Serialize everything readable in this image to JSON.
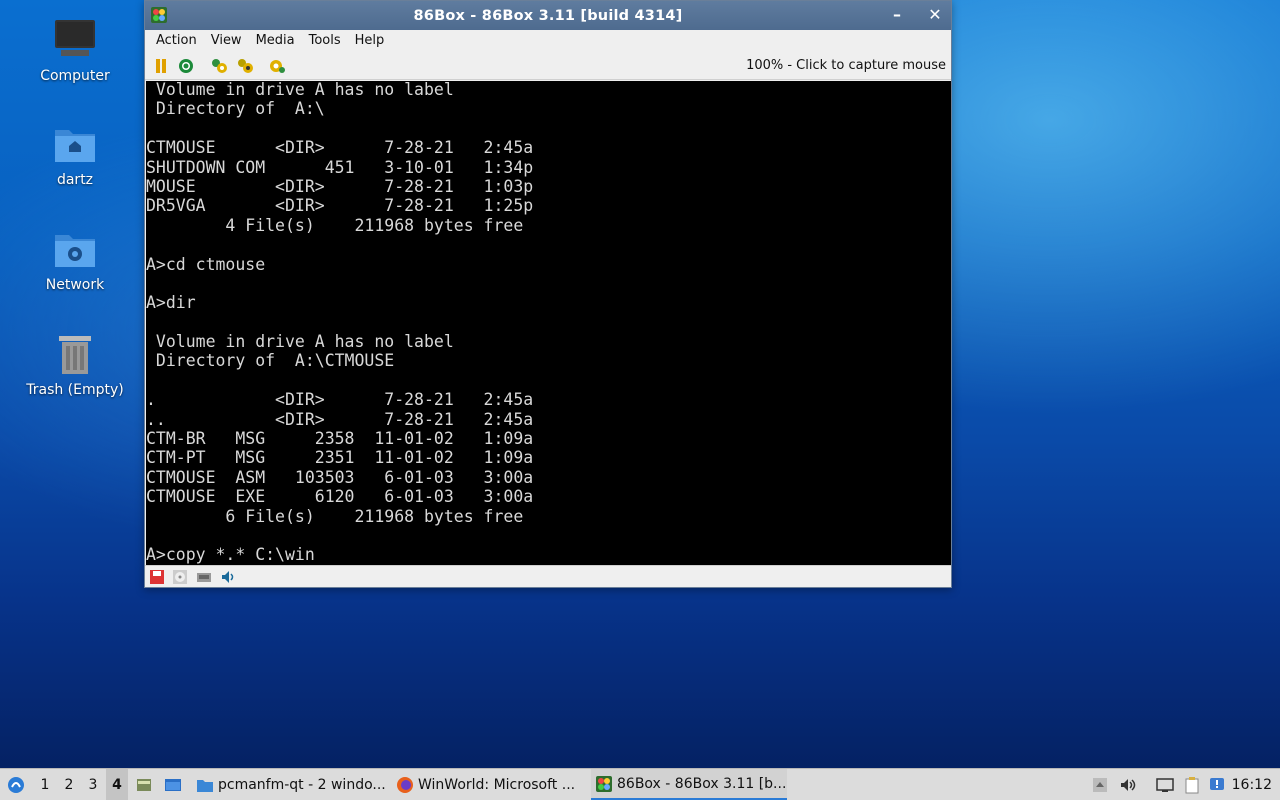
{
  "desktop": {
    "icons": [
      {
        "label": "Computer"
      },
      {
        "label": "dartz"
      },
      {
        "label": "Network"
      },
      {
        "label": "Trash (Empty)"
      }
    ]
  },
  "window": {
    "title": "86Box - 86Box 3.11 [build 4314]",
    "menu": [
      "Action",
      "View",
      "Media",
      "Tools",
      "Help"
    ],
    "toolbar": {
      "icons": [
        "pause-icon",
        "reset-icon",
        "ctrl-alt-del-icon",
        "ctrl-alt-esc-icon",
        "settings-icon"
      ],
      "status_text": "100% - Click to capture mouse"
    },
    "screen_lines": [
      " Volume in drive A has no label",
      " Directory of  A:\\",
      "",
      "CTMOUSE      <DIR>      7-28-21   2:45a",
      "SHUTDOWN COM      451   3-10-01   1:34p",
      "MOUSE        <DIR>      7-28-21   1:03p",
      "DR5VGA       <DIR>      7-28-21   1:25p",
      "        4 File(s)    211968 bytes free",
      "",
      "A>cd ctmouse",
      "",
      "A>dir",
      "",
      " Volume in drive A has no label",
      " Directory of  A:\\CTMOUSE",
      "",
      ".            <DIR>      7-28-21   2:45a",
      "..           <DIR>      7-28-21   2:45a",
      "CTM-BR   MSG     2358  11-01-02   1:09a",
      "CTM-PT   MSG     2351  11-01-02   1:09a",
      "CTMOUSE  ASM   103503   6-01-03   3:00a",
      "CTMOUSE  EXE     6120   6-01-03   3:00a",
      "        6 File(s)    211968 bytes free",
      "",
      "A>copy *.* C:\\win"
    ],
    "statusbar_icons": [
      "floppy-icon",
      "cdrom-icon",
      "hdd-icon",
      "sound-icon"
    ]
  },
  "taskbar": {
    "desktops": [
      "1",
      "2",
      "3",
      "4"
    ],
    "active_desktop": "4",
    "tasks": [
      {
        "label": "pcmanfm-qt - 2 windo..."
      },
      {
        "label": "WinWorld: Microsoft ..."
      },
      {
        "label": "86Box - 86Box 3.11 [b..."
      }
    ],
    "clock": "16:12"
  }
}
